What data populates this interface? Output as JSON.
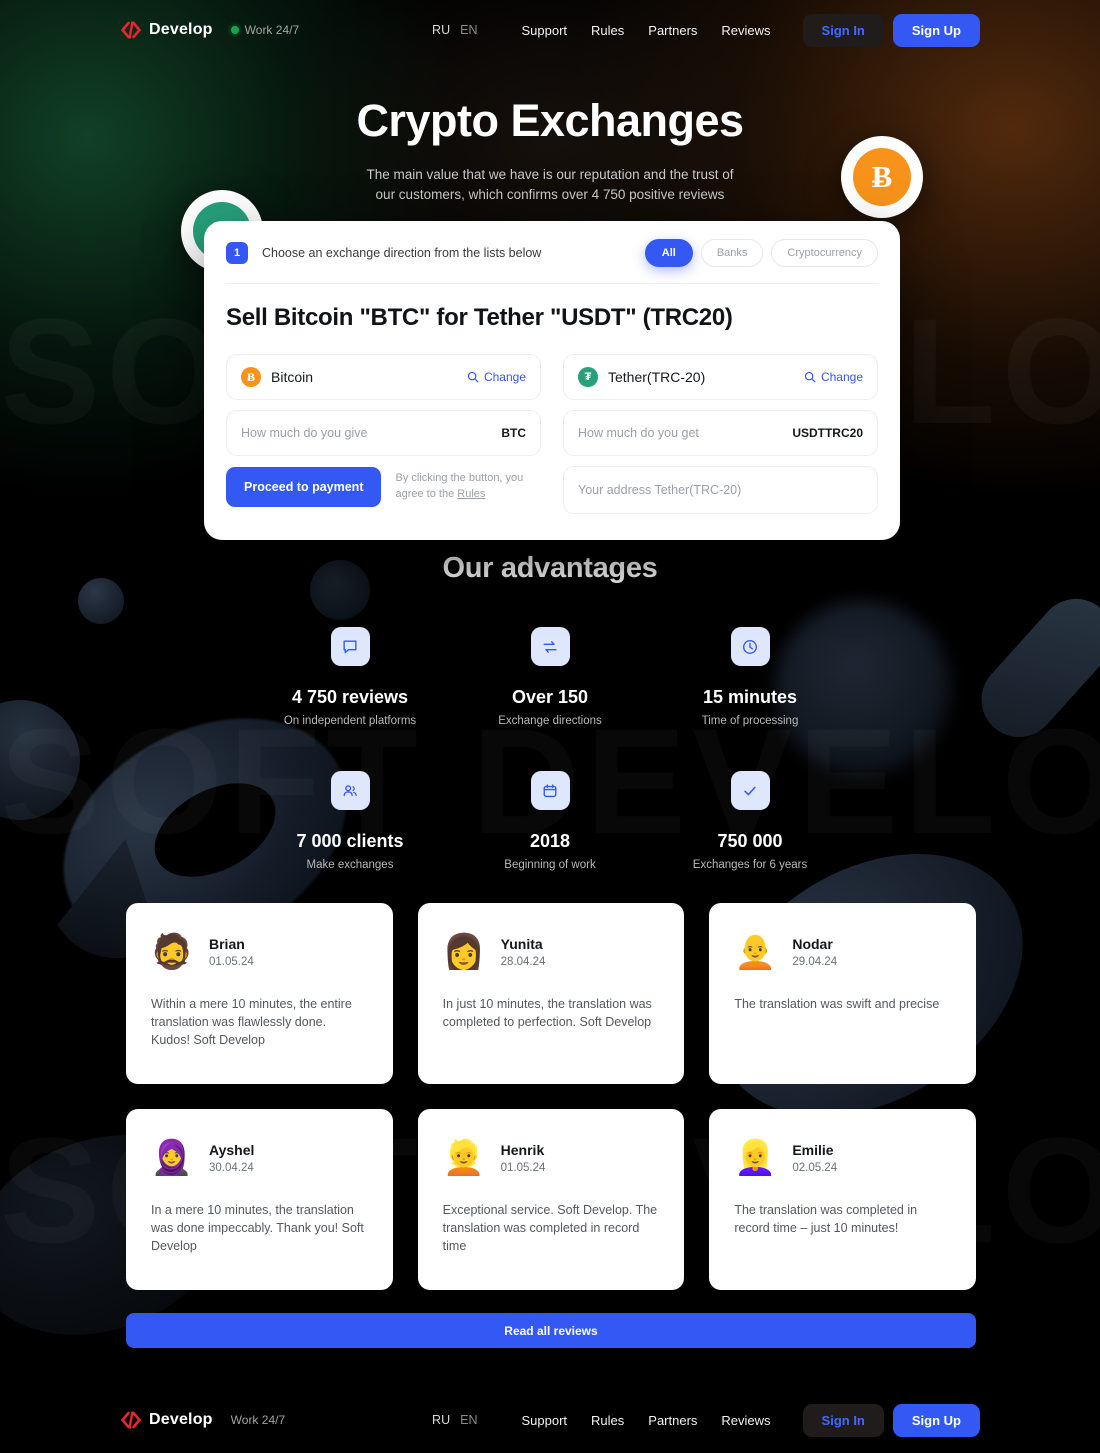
{
  "header": {
    "brand": "Develop",
    "brand_icon": "code-slash-logo-icon",
    "status_text": "Work 24/7",
    "status_color": "#16a34a",
    "languages": [
      {
        "code": "RU",
        "active": true
      },
      {
        "code": "EN",
        "active": false
      }
    ],
    "nav_links": [
      "Support",
      "Rules",
      "Partners",
      "Reviews"
    ],
    "sign_in": "Sign In",
    "sign_up": "Sign Up"
  },
  "hero": {
    "title": "Crypto Exchanges",
    "subtitle_line1": "The main value that we have is our reputation and the trust of",
    "subtitle_line2": "our customers, which confirms over 4 750 positive reviews",
    "coin_btc_symbol": "Ƀ",
    "coin_usdt_symbol": "₮"
  },
  "widget": {
    "step_number": "1",
    "step_text": "Choose an exchange direction from the lists below",
    "filters": [
      {
        "label": "All",
        "active": true
      },
      {
        "label": "Banks",
        "active": false
      },
      {
        "label": "Cryptocurrency",
        "active": false
      }
    ],
    "title": "Sell Bitcoin \"BTC\" for Tether \"USDT\" (TRC20)",
    "give": {
      "coin_name": "Bitcoin",
      "coin_symbol": "Ƀ",
      "change_label": "Change",
      "amount_placeholder": "How much do you give",
      "amount_value": "",
      "unit": "BTC"
    },
    "get": {
      "coin_name": "Tether(TRC-20)",
      "coin_symbol": "₮",
      "change_label": "Change",
      "amount_placeholder": "How much do you get",
      "amount_value": "",
      "unit": "USDTTRC20",
      "address_placeholder": "Your address Tether(TRC-20)",
      "address_value": ""
    },
    "proceed_label": "Proceed to payment",
    "agree_prefix": "By clicking the button, you agree to the ",
    "agree_link": "Rules"
  },
  "advantages": {
    "title": "Our advantages",
    "items": [
      {
        "icon": "chat-bubble-icon",
        "value": "4 750 reviews",
        "label": "On independent platforms"
      },
      {
        "icon": "exchange-arrows-icon",
        "value": "Over 150",
        "label": "Exchange directions"
      },
      {
        "icon": "clock-icon",
        "value": "15 minutes",
        "label": "Time of processing"
      },
      {
        "icon": "users-icon",
        "value": "7 000 clients",
        "label": "Make exchanges"
      },
      {
        "icon": "calendar-icon",
        "value": "2018",
        "label": "Beginning of work"
      },
      {
        "icon": "check-icon",
        "value": "750 000",
        "label": "Exchanges for 6 years"
      }
    ]
  },
  "reviews": {
    "cards": [
      {
        "avatar": "🧔",
        "name": "Brian",
        "date": "01.05.24",
        "text": "Within a mere 10 minutes, the entire translation was flawlessly done. Kudos! Soft Develop"
      },
      {
        "avatar": "👩",
        "name": "Yunita",
        "date": "28.04.24",
        "text": "In just 10 minutes, the translation was completed to perfection. Soft Develop"
      },
      {
        "avatar": "🧑‍🦲",
        "name": "Nodar",
        "date": "29.04.24",
        "text": "The translation was swift and precise"
      },
      {
        "avatar": "🧕",
        "name": "Ayshel",
        "date": "30.04.24",
        "text": "In a mere 10 minutes, the translation was done impeccably. Thank you! Soft Develop"
      },
      {
        "avatar": "👱",
        "name": "Henrik",
        "date": "01.05.24",
        "text": "Exceptional service. Soft Develop. The translation was completed in record time"
      },
      {
        "avatar": "👱‍♀️",
        "name": "Emilie",
        "date": "02.05.24",
        "text": "The translation was completed in record time – just 10 minutes!"
      }
    ],
    "read_all_label": "Read all reviews"
  },
  "footer": {
    "brand": "Develop",
    "status_text": "Work 24/7",
    "languages": [
      {
        "code": "RU",
        "active": true
      },
      {
        "code": "EN",
        "active": false
      }
    ],
    "nav_links": [
      "Support",
      "Rules",
      "Partners",
      "Reviews"
    ],
    "sign_in": "Sign In",
    "sign_up": "Sign Up"
  },
  "watermark": {
    "line1": "SOFT DEVELOP",
    "line2": "SOFT DEVELOP",
    "line3": "SOFT DEVELOP"
  },
  "colors": {
    "accent": "#3358f4",
    "bitcoin": "#f7931a",
    "tether": "#26a17b",
    "status_green": "#16a34a",
    "brand_red": "#e8262d"
  }
}
